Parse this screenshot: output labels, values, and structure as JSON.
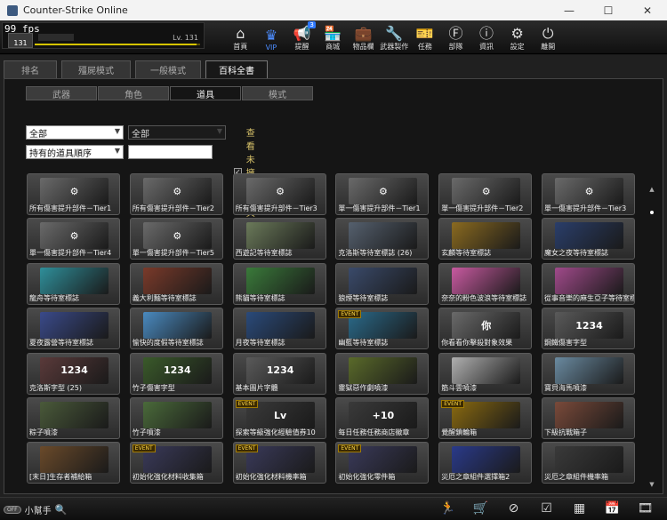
{
  "window": {
    "title": "Counter-Strike Online",
    "minimize": "—",
    "maximize": "☐",
    "close": "✕"
  },
  "player": {
    "fps": "99 fps",
    "avatar_level": "131",
    "level": "Lv. 131",
    "xp_fraction": 0.98
  },
  "nav": [
    {
      "label": "首頁",
      "icon": "home-icon",
      "glyph": "⌂"
    },
    {
      "label": "VIP",
      "icon": "crown-icon",
      "glyph": "♛"
    },
    {
      "label": "提醒",
      "icon": "megaphone-icon",
      "glyph": "📢",
      "badge": "3"
    },
    {
      "label": "商城",
      "icon": "shop-icon",
      "glyph": "🏪"
    },
    {
      "label": "物品欄",
      "icon": "bag-icon",
      "glyph": "💼"
    },
    {
      "label": "武器製作",
      "icon": "weapon-craft-icon",
      "glyph": "🔧"
    },
    {
      "label": "任務",
      "icon": "ticket-icon",
      "glyph": "🎫"
    },
    {
      "label": "部隊",
      "icon": "clan-icon",
      "glyph": "Ⓕ"
    },
    {
      "label": "資訊",
      "icon": "info-icon",
      "glyph": "ⓘ"
    },
    {
      "label": "設定",
      "icon": "gear-icon",
      "glyph": "⚙"
    },
    {
      "label": "離開",
      "icon": "power-icon",
      "glyph": "⏻"
    }
  ],
  "tabs": [
    "排名",
    "殭屍模式",
    "一般模式",
    "百科全書"
  ],
  "active_tab": 3,
  "subtabs": [
    "武器",
    "角色",
    "道具",
    "模式"
  ],
  "active_subtab": 2,
  "filters": {
    "category": "全部",
    "subcategory": "全部",
    "sort": "持有的道具順序",
    "search": "",
    "show_unowned_label": "查看未擁有道具",
    "show_unowned_checked": "✓"
  },
  "items": [
    {
      "label": "所有傷害提升部件－Tier1",
      "color": "#6a6a6a",
      "mark": "⚙"
    },
    {
      "label": "所有傷害提升部件－Tier2",
      "color": "#6a6a6a",
      "mark": "⚙"
    },
    {
      "label": "所有傷害提升部件－Tier3",
      "color": "#6a6a6a",
      "mark": "⚙"
    },
    {
      "label": "單一傷害提升部件－Tier1",
      "color": "#6a6a6a",
      "mark": "⚙"
    },
    {
      "label": "單一傷害提升部件－Tier2",
      "color": "#6a6a6a",
      "mark": "⚙"
    },
    {
      "label": "單一傷害提升部件－Tier3",
      "color": "#6a6a6a",
      "mark": "⚙"
    },
    {
      "label": "單一傷害提升部件－Tier4",
      "color": "#6a6a6a",
      "mark": "⚙"
    },
    {
      "label": "單一傷害提升部件－Tier5",
      "color": "#6a6a6a",
      "mark": "⚙"
    },
    {
      "label": "西遊記等待室標誌",
      "color": "#6b7a5a",
      "mark": ""
    },
    {
      "label": "克洛斯等待室標誌 (26)",
      "color": "#55606e",
      "mark": ""
    },
    {
      "label": "玄麟等待室標誌",
      "color": "#8a6a20",
      "mark": ""
    },
    {
      "label": "魔女之夜等待室標誌",
      "color": "#2a3e6a",
      "mark": ""
    },
    {
      "label": "龍舟等待室標誌",
      "color": "#2f8f9a",
      "mark": ""
    },
    {
      "label": "義大利麵等待室標誌",
      "color": "#7a3a2a",
      "mark": ""
    },
    {
      "label": "熊貓等待室標誌",
      "color": "#3a7a3a",
      "mark": ""
    },
    {
      "label": "狼煙等待室標誌",
      "color": "#3a4a6a",
      "mark": ""
    },
    {
      "label": "奈奈的粉色波浪等待室標誌",
      "color": "#c85aa0",
      "mark": ""
    },
    {
      "label": "從事音樂的麻生亞子等待室標誌",
      "color": "#a04a8a",
      "mark": ""
    },
    {
      "label": "夏夜露營等待室標誌",
      "color": "#3a4a8a",
      "mark": ""
    },
    {
      "label": "愉快的度假等待室標誌",
      "color": "#4a8ac0",
      "mark": ""
    },
    {
      "label": "月夜等待室標誌",
      "color": "#2a4a7a",
      "mark": ""
    },
    {
      "label": "幽藍等待室標誌",
      "color": "#2a6a8a",
      "mark": "",
      "event": "EVENT"
    },
    {
      "label": "你看看你擊殺對象效果",
      "color": "#6a6a6a",
      "mark": "你"
    },
    {
      "label": "鋼鐵傷害字型",
      "color": "#5a5a5a",
      "mark": "1234"
    },
    {
      "label": "克洛斯字型 (25)",
      "color": "#5a3a3a",
      "mark": "1234"
    },
    {
      "label": "竹子傷害字型",
      "color": "#3a5a2a",
      "mark": "1234"
    },
    {
      "label": "基本圖片字體",
      "color": "#5a5a5a",
      "mark": "1234"
    },
    {
      "label": "靈獄惡作劇噴漆",
      "color": "#5a6a2a",
      "mark": ""
    },
    {
      "label": "筋斗雲噴漆",
      "color": "#b0b0b0",
      "mark": ""
    },
    {
      "label": "寶貝海馬噴漆",
      "color": "#6a8aa0",
      "mark": ""
    },
    {
      "label": "粽子噴漆",
      "color": "#4a5a3a",
      "mark": ""
    },
    {
      "label": "竹子噴漆",
      "color": "#4a6a3a",
      "mark": ""
    },
    {
      "label": "探索等級強化經驗值券10",
      "color": "#3a3a3a",
      "mark": "Lv",
      "event": "EVENT"
    },
    {
      "label": "每日任務任務商店徽章",
      "color": "#3a3a3a",
      "mark": "+10"
    },
    {
      "label": "覺醒鎖輪箱",
      "color": "#8a6a10",
      "mark": "",
      "event": "EVENT"
    },
    {
      "label": "下級抗戰箱子",
      "color": "#7a4a3a",
      "mark": ""
    },
    {
      "label": "[末日]生存者補給箱",
      "color": "#6a4a2a",
      "mark": ""
    },
    {
      "label": "初始化強化材料收集箱",
      "color": "#3a3a5a",
      "mark": "",
      "event": "EVENT"
    },
    {
      "label": "初始化強化材料機率箱",
      "color": "#3a3a5a",
      "mark": "",
      "event": "EVENT"
    },
    {
      "label": "初始化強化零件箱",
      "color": "#3a3a5a",
      "mark": "",
      "event": "EVENT"
    },
    {
      "label": "災厄之章組件選擇箱2",
      "color": "#2a3a8a",
      "mark": ""
    },
    {
      "label": "災厄之章組件機率箱",
      "color": "#3a3a3a",
      "mark": ""
    }
  ],
  "bottom": {
    "helper_pill": "OFF",
    "helper_label": "小幫手",
    "icons": [
      "runner-icon",
      "cart-icon",
      "compass-icon",
      "checklist-icon",
      "chest-icon",
      "calendar-icon",
      "film-icon"
    ]
  }
}
